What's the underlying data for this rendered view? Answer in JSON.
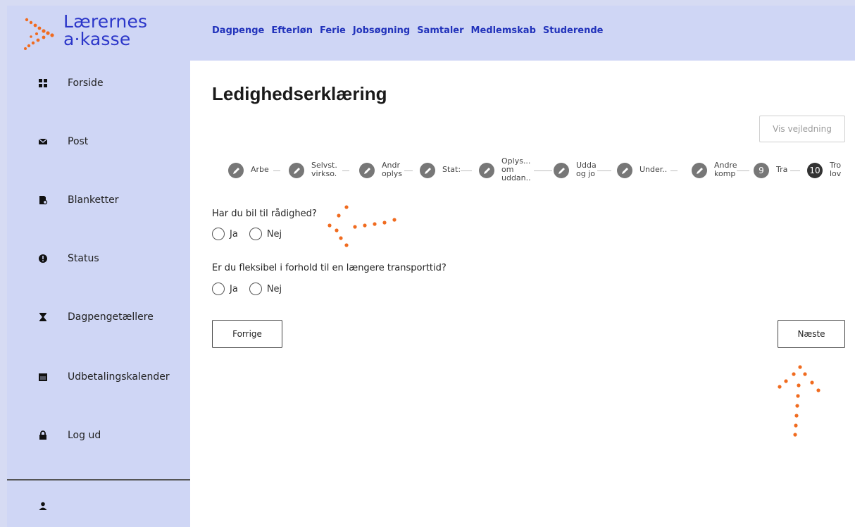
{
  "brand": {
    "line1": "Lærernes",
    "line2": "a·kasse",
    "color": "#2b36c9",
    "accent": "#f06b1f"
  },
  "topnav": [
    "Dagpenge",
    "Efterløn",
    "Ferie",
    "Jobsøgning",
    "Samtaler",
    "Medlemskab",
    "Studerende"
  ],
  "sidebar": {
    "items": [
      {
        "label": "Forside",
        "icon": "grid-icon"
      },
      {
        "label": "Post",
        "icon": "envelope-icon"
      },
      {
        "label": "Blanketter",
        "icon": "document-search-icon"
      },
      {
        "label": "Status",
        "icon": "exclamation-circle-icon"
      },
      {
        "label": "Dagpengetællere",
        "icon": "hourglass-icon"
      },
      {
        "label": "Udbetalingskalender",
        "icon": "calendar-icon"
      },
      {
        "label": "Log ud",
        "icon": "lock-icon"
      }
    ],
    "profile_icon": "user-icon"
  },
  "main": {
    "title": "Ledighedserklæring",
    "guide_button": "Vis vejledning",
    "steps": [
      {
        "label": "Arbe",
        "icon": "pencil-icon"
      },
      {
        "label": "Selvst.\nvirkso.",
        "icon": "pencil-icon"
      },
      {
        "label": "Andr\noplys",
        "icon": "pencil-icon"
      },
      {
        "label": "Stat:",
        "icon": "pencil-icon"
      },
      {
        "label": "Oplys...\nom\nuddan..",
        "icon": "pencil-icon"
      },
      {
        "label": "Udda\nog jo",
        "icon": "pencil-icon"
      },
      {
        "label": "Under..",
        "icon": "pencil-icon"
      },
      {
        "label": "Andre\nkomp",
        "icon": "pencil-icon"
      },
      {
        "label": "Tra",
        "number": "9"
      },
      {
        "label": "Tro\nlov",
        "number": "10"
      }
    ],
    "questions": [
      {
        "text": "Har du bil til rådighed?",
        "options": [
          "Ja",
          "Nej"
        ]
      },
      {
        "text": "Er du fleksibel i forhold til en længere transporttid?",
        "options": [
          "Ja",
          "Nej"
        ]
      }
    ],
    "prev_button": "Forrige",
    "next_button": "Næste"
  }
}
